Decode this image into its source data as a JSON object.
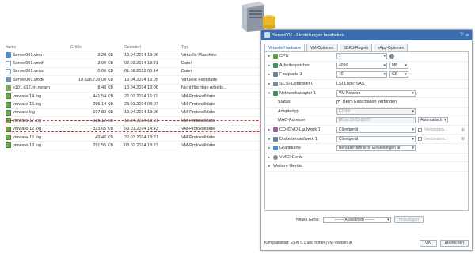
{
  "files": {
    "columns": [
      "Name",
      "Größe",
      "Geändert",
      "Typ"
    ],
    "rows": [
      {
        "name": "Server001.vmx",
        "size": "3,29 KB",
        "date": "13.04.2014 13:06",
        "type": "Virtuelle Maschine",
        "icon": "vm-file-icon"
      },
      {
        "name": "Server001.vmxf",
        "size": "3,00 KB",
        "date": "02.03.2014 18:21",
        "type": "Datei",
        "icon": "document-icon"
      },
      {
        "name": "Server001.vmsd",
        "size": "0,00 KB",
        "date": "01.08.2013 00:14",
        "type": "Datei",
        "icon": "document-icon"
      },
      {
        "name": "Server001.vmdk",
        "size": "19.828.736,00 KB",
        "date": "13.04.2014 13:05",
        "type": "Virtuelle Festplatte",
        "icon": "virtual-disk-icon"
      },
      {
        "name": "s101.d12.int.nvram",
        "size": "8,48 KB",
        "date": "13.04.2014 13:06",
        "type": "Nicht flüchtige Arbeits...",
        "icon": "nvram-icon"
      },
      {
        "name": "vmware-14.log",
        "size": "441,54 KB",
        "date": "22.03.2014 16:11",
        "type": "VM-Protokolldatei",
        "icon": "log-file-icon"
      },
      {
        "name": "vmware-16.log",
        "size": "295,14 KB",
        "date": "23.03.2014 08:07",
        "type": "VM-Protokolldatei",
        "icon": "log-file-icon"
      },
      {
        "name": "vmware.log",
        "size": "197,83 KB",
        "date": "13.04.2014 13:06",
        "type": "VM-Protokolldatei",
        "icon": "log-file-icon"
      },
      {
        "name": "vmware-17.log",
        "size": "215,12 KB",
        "date": "13.04.2014 13:01",
        "type": "VM-Protokolldatei",
        "icon": "log-file-icon"
      },
      {
        "name": "vmware-12.log",
        "size": "323,65 KB",
        "date": "09.01.2014 14:43",
        "type": "VM-Protokolldatei",
        "icon": "log-file-icon"
      },
      {
        "name": "vmware-15.log",
        "size": "49,46 KB",
        "date": "22.03.2014 18:21",
        "type": "VM-Protokolldatei",
        "icon": "log-file-icon"
      },
      {
        "name": "vmware-13.log",
        "size": "291,55 KB",
        "date": "08.02.2014 18:23",
        "type": "VM-Protokolldatei",
        "icon": "log-file-icon"
      }
    ]
  },
  "dialog": {
    "title": "Server001 - Einstellungen bearbeiten",
    "help": "?",
    "expand": "»",
    "tabs": [
      "Virtuelle Hardware",
      "VM-Optionen",
      "SDRS-Regeln",
      "vApp-Optionen"
    ],
    "hardware": {
      "cpu": {
        "label": "CPU",
        "value": "1"
      },
      "ram": {
        "label": "Arbeitsspeicher",
        "value": "4096",
        "unit": "MB"
      },
      "disk": {
        "label": "Festplatte 1",
        "value": "40",
        "unit": "GB"
      },
      "scsi": {
        "label": "SCSI-Controller 0",
        "value": "LSI Logic SAS"
      },
      "net": {
        "label": "Netzwerkadapter 1",
        "value": "VM Network"
      },
      "status": {
        "label": "Status",
        "value": "Beim Einschalten verbinden"
      },
      "adapter": {
        "label": "Adaptertyp",
        "value": "E1000"
      },
      "mac": {
        "label": "MAC-Adresse",
        "value": "00:0c:29:23:02:07",
        "mode": "Automatisch"
      },
      "cd": {
        "label": "CD-/DVD-Laufwerk 1",
        "value": "Clientgerät",
        "connect": "Verbinden..."
      },
      "floppy": {
        "label": "Diskettenlaufwerk 1",
        "value": "Clientgerät",
        "connect": "Verbinden..."
      },
      "video": {
        "label": "Grafikkarte",
        "value": "Benutzerdefinierte Einstellungen an"
      },
      "vmci": {
        "label": "VMCI-Gerät"
      },
      "other": {
        "label": "Weitere Geräte"
      }
    },
    "new_device": {
      "label": "Neues Gerät:",
      "select": "------- Auswählen -------",
      "add": "Hinzufügen"
    },
    "compat": "Kompatibilität: ESXi 5.1 und höher (VM-Version 9)",
    "ok": "OK",
    "cancel": "Abbrechen"
  },
  "colors": {
    "title_bar": "#3b6db0",
    "highlight": "#e02b2b",
    "active_tab": "#1f56a0"
  }
}
